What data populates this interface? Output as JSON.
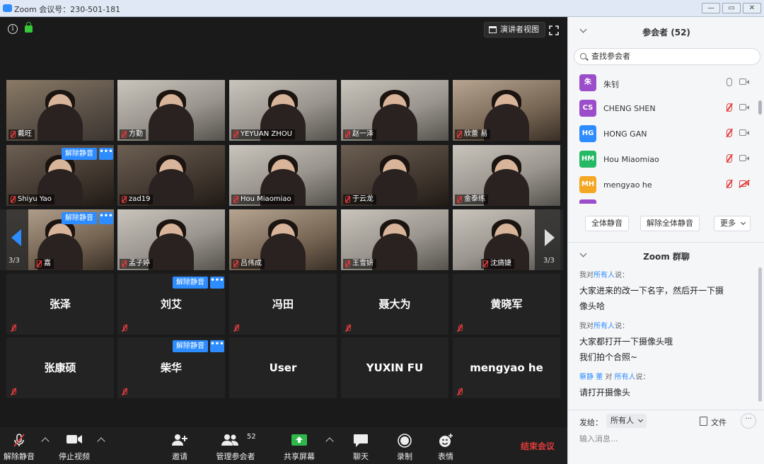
{
  "window": {
    "title": "Zoom 会议号：230-501-181"
  },
  "video": {
    "speaker_view": "演讲者视图",
    "tiles_row1": [
      "戴旺",
      "方勤",
      "YEYUAN ZHOU",
      "赵一泽",
      "欣蕾 易"
    ],
    "tiles_row2": [
      "Shiyu Yao",
      "zad19",
      "Hou Miaomiao",
      "于云龙",
      "金泰练"
    ],
    "tiles_row3": [
      "嘉",
      "孟子婷",
      "吕伟成",
      "王雪妍",
      "沈旖婕"
    ],
    "tiles_row4": [
      "张泽",
      "刘艾",
      "冯田",
      "聂大为",
      "黄晓军"
    ],
    "tiles_row5": [
      "张康硕",
      "柴华",
      "User",
      "YUXIN FU",
      "mengyao he"
    ],
    "unmute_label": "解除静音",
    "more_label": "•••",
    "page_left": "3/3",
    "page_right": "3/3"
  },
  "toolbar": {
    "unmute": "解除静音",
    "stop_video": "停止视频",
    "invite": "邀请",
    "manage": "管理参会者",
    "participant_count": "52",
    "share": "共享屏幕",
    "chat": "聊天",
    "record": "录制",
    "reactions": "表情",
    "end": "结束会议"
  },
  "panel": {
    "title": "参会者 (52)",
    "search_placeholder": "查找参会者",
    "participants": [
      {
        "initial": "朱",
        "name": "朱钊",
        "color": "#9b4dca"
      },
      {
        "initial": "CS",
        "name": "CHENG SHEN",
        "color": "#9b4dca"
      },
      {
        "initial": "HG",
        "name": "HONG GAN",
        "color": "#2d8cff"
      },
      {
        "initial": "HM",
        "name": "Hou Miaomiao",
        "color": "#25b865"
      },
      {
        "initial": "MH",
        "name": "mengyao he",
        "color": "#f5a623"
      }
    ],
    "mute_all": "全体静音",
    "unmute_all": "解除全体静音",
    "more": "更多"
  },
  "chat": {
    "title": "Zoom 群聊",
    "messages": [
      {
        "from_prefix": "我对",
        "from_target": "所有人",
        "from_suffix": "说：",
        "lines": [
          "大家进来的改一下名字，然后开一下摄",
          "像头哈"
        ]
      },
      {
        "from_prefix": "我对",
        "from_target": "所有人",
        "from_suffix": "说：",
        "lines": [
          "大家都打开一下摄像头哦",
          "我们拍个合照~"
        ]
      },
      {
        "from_prefix": "蔡静 董",
        "from_target": "所有人",
        "from_suffix": "说：",
        "lines": [
          "请打开摄像头"
        ]
      }
    ],
    "send_to_label": "发给：",
    "send_to_value": "所有人",
    "file_label": "文件",
    "more": "···",
    "input_placeholder": "输入消息..."
  }
}
